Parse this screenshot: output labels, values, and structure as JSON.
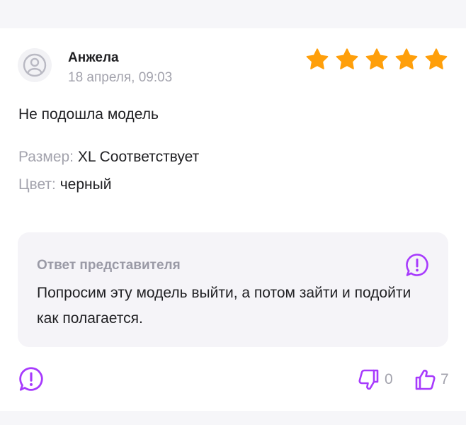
{
  "review": {
    "author": "Анжела",
    "date": "18 апреля, 09:03",
    "rating": 5,
    "rating_max": 5,
    "text": "Не подошла модель",
    "size_label": "Размер:",
    "size_value": "XL Соответствует",
    "color_label": "Цвет:",
    "color_value": "черный"
  },
  "answer": {
    "title": "Ответ представителя",
    "text": "Попросим эту модель выйти, а потом зайти и подойти как полагается."
  },
  "votes": {
    "dislikes": "0",
    "likes": "7"
  },
  "colors": {
    "accent": "#a73afd",
    "star": "#ff9f0a",
    "muted": "#a3a3ad",
    "text": "#1f1f22",
    "panel": "#f5f4f8"
  },
  "icons": {
    "avatar": "user-avatar-icon",
    "star": "star-icon",
    "report": "exclamation-bubble-icon",
    "dislike": "thumbs-down-icon",
    "like": "thumbs-up-icon"
  }
}
